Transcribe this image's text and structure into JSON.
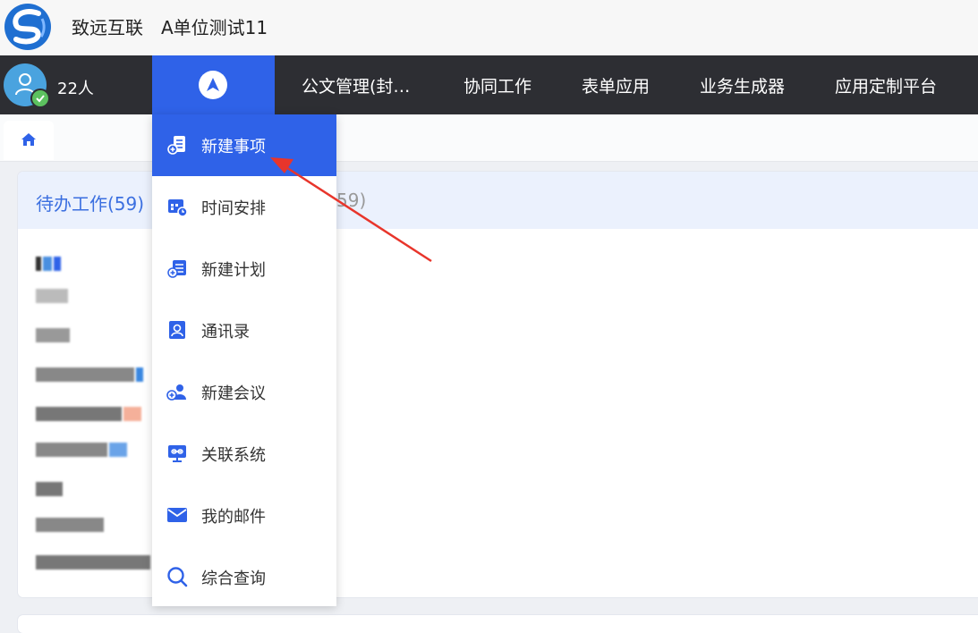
{
  "brand": {
    "company": "致远互联",
    "unit": "A单位测试11"
  },
  "nav": {
    "online_count": "22人",
    "items": [
      "公文管理(封…",
      "协同工作",
      "表单应用",
      "业务生成器",
      "应用定制平台"
    ]
  },
  "card": {
    "tab_pending": "待办工作(59)",
    "tab_other_suffix": "59)"
  },
  "dropdown": {
    "items": [
      {
        "label": "新建事项",
        "icon": "new-item-icon",
        "active": true
      },
      {
        "label": "时间安排",
        "icon": "calendar-clock-icon"
      },
      {
        "label": "新建计划",
        "icon": "new-plan-icon"
      },
      {
        "label": "通讯录",
        "icon": "contacts-icon"
      },
      {
        "label": "新建会议",
        "icon": "new-meeting-icon"
      },
      {
        "label": "关联系统",
        "icon": "linked-system-icon"
      },
      {
        "label": "我的邮件",
        "icon": "mail-icon"
      },
      {
        "label": "综合查询",
        "icon": "search-icon"
      }
    ]
  },
  "colors": {
    "accent": "#2f62e8",
    "nav_bg": "#2d2e33",
    "annotation": "#e8352b"
  }
}
